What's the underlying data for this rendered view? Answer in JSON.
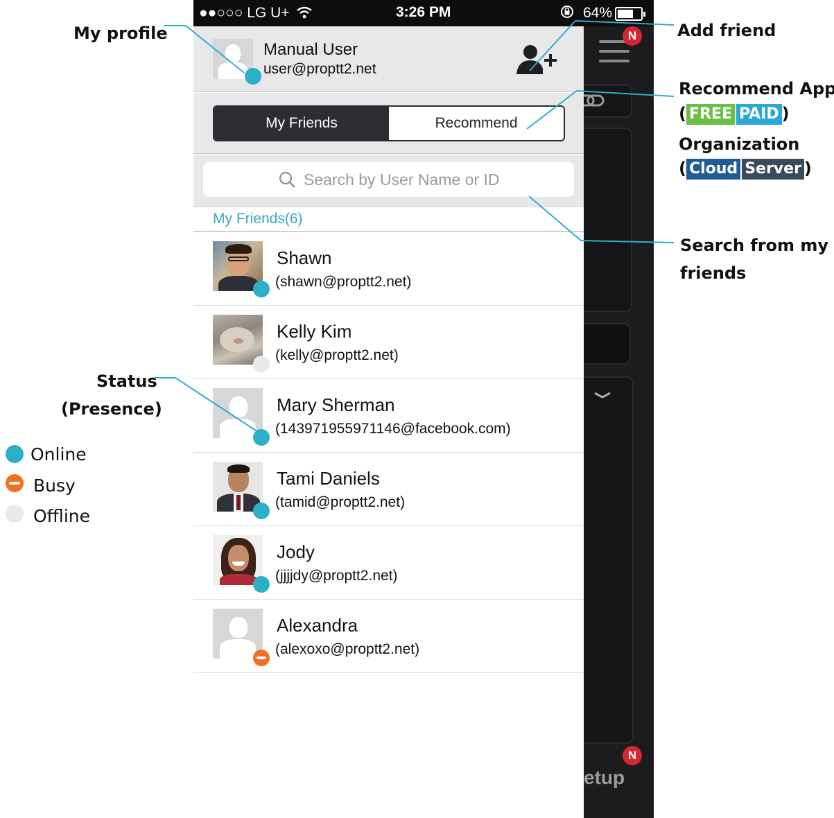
{
  "status_bar": {
    "carrier": "●●○○○ LG U+",
    "time": "3:26 PM",
    "battery": "64%"
  },
  "profile": {
    "name": "Manual User",
    "email": "user@proptt2.net",
    "status": "online"
  },
  "tabs": [
    {
      "label": "My Friends",
      "active": true
    },
    {
      "label": "Recommend",
      "active": false
    }
  ],
  "search": {
    "placeholder": "Search by User Name or ID"
  },
  "friends_section": {
    "header": "My Friends(6)"
  },
  "friends": [
    {
      "name": "Shawn",
      "id": "(shawn@proptt2.net)",
      "status": "online",
      "avatar": "photo"
    },
    {
      "name": "Kelly Kim",
      "id": "(kelly@proptt2.net)",
      "status": "offline",
      "avatar": "photo"
    },
    {
      "name": "Mary Sherman",
      "id": "(143971955971146@facebook.com)",
      "status": "online",
      "avatar": "placeholder"
    },
    {
      "name": "Tami Daniels",
      "id": "(tamid@proptt2.net)",
      "status": "online",
      "avatar": "photo"
    },
    {
      "name": "Jody",
      "id": "(jjjjdy@proptt2.net)",
      "status": "online",
      "avatar": "photo"
    },
    {
      "name": "Alexandra",
      "id": "(alexoxo@proptt2.net)",
      "status": "busy",
      "avatar": "placeholder"
    }
  ],
  "background_app": {
    "badge_top": "N",
    "badge_bottom": "N",
    "setup_label": "etup"
  },
  "annotations": {
    "my_profile": "My profile",
    "add_friend": "Add friend",
    "recommend_app": "Recommend App",
    "free": "FREE",
    "paid": "PAID",
    "organization": "Organization",
    "cloud": "Cloud",
    "server": "Server",
    "search_line1": "Search from my",
    "search_line2": "friends",
    "status_line1": "Status",
    "status_line2": "(Presence)",
    "open_paren": "(",
    "close_paren": ")"
  },
  "legend": [
    {
      "label": "Online",
      "color": "#2bb0c8"
    },
    {
      "label": "Busy",
      "color": "#f27022"
    },
    {
      "label": "Offline",
      "color": "#e9e9ea"
    }
  ],
  "colors": {
    "accent": "#2bb0c8",
    "busy": "#f27022",
    "free_tag": "#6cbf45",
    "paid_tag": "#2aa7d6",
    "cloud_tag": "#1d5c96",
    "server_tag": "#3a4a5c"
  }
}
